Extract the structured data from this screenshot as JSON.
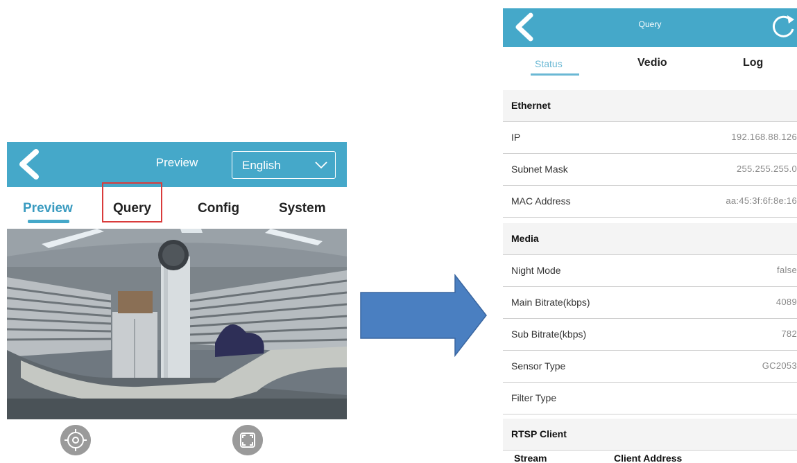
{
  "left": {
    "header": {
      "title": "Preview",
      "language": "English"
    },
    "tabs": [
      {
        "label": "Preview"
      },
      {
        "label": "Query"
      },
      {
        "label": "Config"
      },
      {
        "label": "System"
      }
    ],
    "controls": [
      {
        "icon": "ptz-target-icon"
      },
      {
        "icon": "fullscreen-icon"
      }
    ]
  },
  "right": {
    "header": {
      "title": "Query"
    },
    "tabs": [
      {
        "label": "Status"
      },
      {
        "label": "Vedio"
      },
      {
        "label": "Log"
      }
    ],
    "sections": {
      "ethernet": "Ethernet",
      "media": "Media",
      "rtsp": "RTSP Client"
    },
    "ethernet_rows": [
      {
        "label": "IP",
        "value": "192.168.88.126"
      },
      {
        "label": "Subnet Mask",
        "value": "255.255.255.0"
      },
      {
        "label": "MAC Address",
        "value": "aa:45:3f:6f:8e:16"
      }
    ],
    "media_rows": [
      {
        "label": "Night Mode",
        "value": "false"
      },
      {
        "label": "Main Bitrate(kbps)",
        "value": "4089"
      },
      {
        "label": "Sub Bitrate(kbps)",
        "value": "782"
      },
      {
        "label": "Sensor Type",
        "value": "GC2053"
      },
      {
        "label": "Filter Type",
        "value": ""
      }
    ],
    "rtsp_columns": [
      "Stream",
      "Client Address"
    ]
  },
  "colors": {
    "accent": "#45a8c9",
    "highlight_box": "#d93b3b",
    "arrow": "#4a7fc1"
  }
}
